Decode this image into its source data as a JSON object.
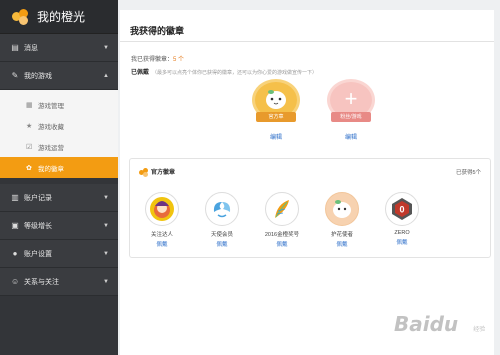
{
  "brand": {
    "title": "我的橙光"
  },
  "nav": [
    {
      "label": "消息",
      "icon": "message-icon",
      "arrow": "▼"
    },
    {
      "label": "我的游戏",
      "icon": "game-icon",
      "arrow": "▲"
    }
  ],
  "sub_nav": [
    {
      "label": "游戏管理",
      "icon": "grid-icon"
    },
    {
      "label": "游戏收藏",
      "icon": "star-icon"
    },
    {
      "label": "游戏运营",
      "icon": "edit-icon"
    },
    {
      "label": "我的徽章",
      "icon": "badge-icon",
      "active": true
    }
  ],
  "nav_bottom": [
    {
      "label": "账户记录",
      "icon": "records-icon",
      "arrow": "▼"
    },
    {
      "label": "等级增长",
      "icon": "level-icon",
      "arrow": "▼"
    },
    {
      "label": "账户设置",
      "icon": "settings-icon",
      "arrow": "▼"
    },
    {
      "label": "关系与关注",
      "icon": "relation-icon",
      "arrow": "▼"
    }
  ],
  "page": {
    "title": "我获得的徽章",
    "count_label": "我已获得徽章：",
    "count_value": "5 个",
    "lit_label": "已佩戴",
    "lit_hint": "（最多可以点亮个体你已获得的徽章，还可以为你心爱的游戏做宣传一下）"
  },
  "featured": [
    {
      "ribbon": "官方章",
      "edit": "编辑",
      "color": "#f5c04a",
      "ribbon_color": "#e89a2c"
    },
    {
      "ribbon": "粉丝/游戏",
      "edit": "编辑",
      "color": "#f7c4c0",
      "ribbon_color": "#e88a86"
    }
  ],
  "official": {
    "title": "官方徽章",
    "count": "已获得5个",
    "badges": [
      {
        "name": "关注达人",
        "status": "佩戴",
        "icon": "character-badge-icon",
        "color": "#e86b3a"
      },
      {
        "name": "天使会员",
        "status": "佩戴",
        "icon": "wings-badge-icon",
        "color": "#4aa3df"
      },
      {
        "name": "2016金橙奖号",
        "status": "佩戴",
        "icon": "feather-badge-icon",
        "color": "#6bbf7a"
      },
      {
        "name": "护花使者",
        "status": "佩戴",
        "icon": "mascot-badge-icon",
        "color": "#f2c69b"
      },
      {
        "name": "ZERO",
        "status": "佩戴",
        "icon": "zero-badge-icon",
        "color": "#c0392b"
      }
    ]
  },
  "watermark": {
    "brand": "Baidu",
    "sub": "经验"
  }
}
